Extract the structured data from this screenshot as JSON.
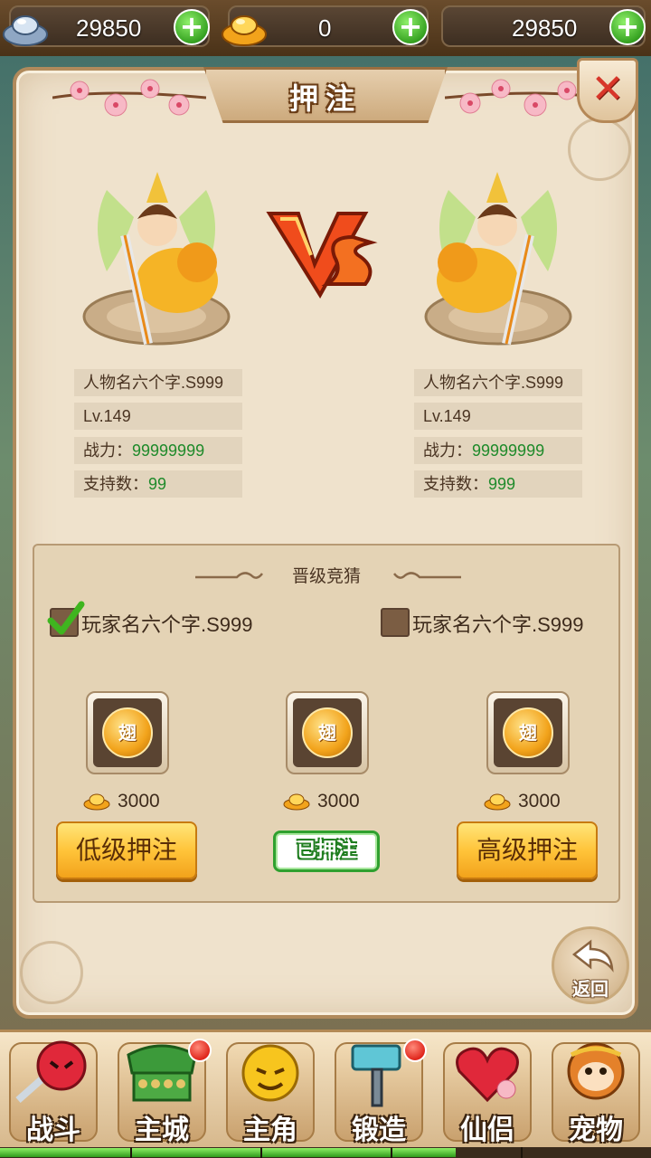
{
  "currency": {
    "silver": "29850",
    "gold": "0",
    "third": "29850",
    "add_symbol": "+"
  },
  "title": "押注",
  "close_symbol": "✕",
  "fighters": [
    {
      "name": "人物名六个字.S999",
      "level": "Lv.149",
      "power_label": "战力：",
      "power": "99999999",
      "support_label": "支持数：",
      "support": "99"
    },
    {
      "name": "人物名六个字.S999",
      "level": "Lv.149",
      "power_label": "战力：",
      "power": "99999999",
      "support_label": "支持数：",
      "support": "999"
    }
  ],
  "betting": {
    "title": "晋级竞猜",
    "players": [
      {
        "name": "玩家名六个字.S999",
        "checked": true
      },
      {
        "name": "玩家名六个字.S999",
        "checked": false
      }
    ],
    "slot_glyph": "翅",
    "options": [
      {
        "price": "3000",
        "button": "低级押注",
        "state": "button"
      },
      {
        "price": "3000",
        "button": "已押注",
        "state": "done"
      },
      {
        "price": "3000",
        "button": "高级押注",
        "state": "button"
      }
    ]
  },
  "back_label": "返回",
  "nav": [
    {
      "label": "战斗",
      "icon": "battle-icon",
      "badge": false
    },
    {
      "label": "主城",
      "icon": "city-icon",
      "badge": true
    },
    {
      "label": "主角",
      "icon": "hero-icon",
      "badge": false
    },
    {
      "label": "锻造",
      "icon": "hammer-icon",
      "badge": true
    },
    {
      "label": "仙侣",
      "icon": "heart-icon",
      "badge": false
    },
    {
      "label": "宠物",
      "icon": "monkey-icon",
      "badge": false
    }
  ],
  "xp_progress": 0.7,
  "colors": {
    "accent_green": "#1e8a2a",
    "button_yellow": "#ffc43a",
    "panel": "#efe2cc"
  }
}
